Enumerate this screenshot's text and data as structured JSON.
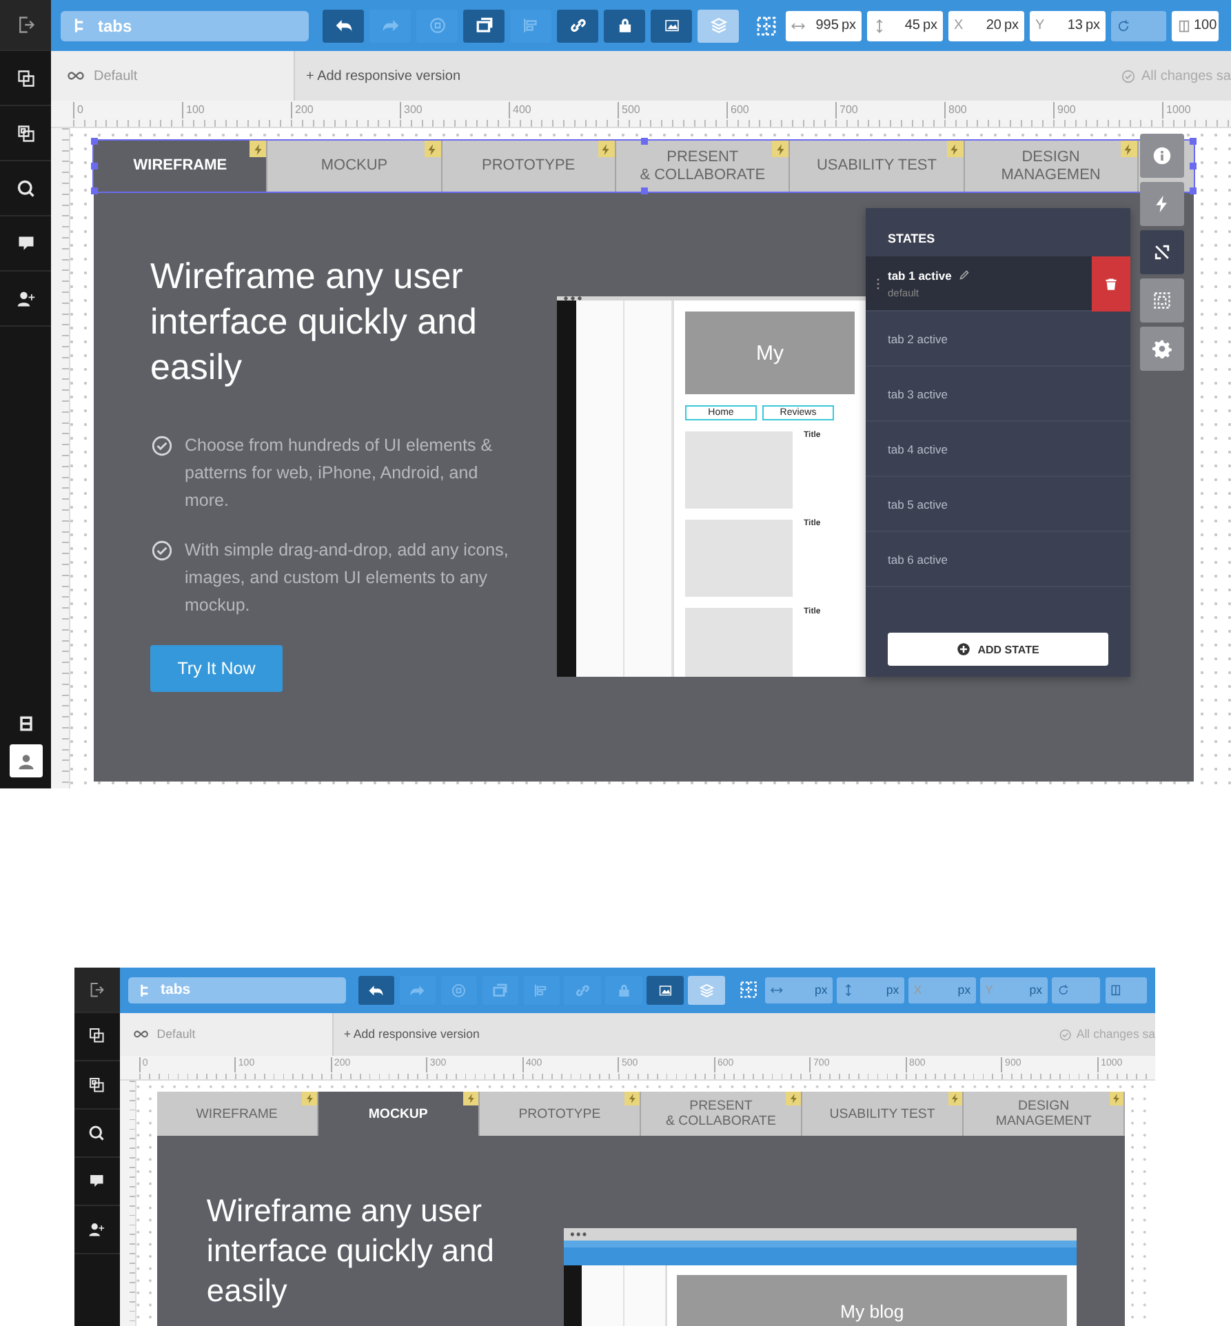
{
  "screens": [
    {
      "kind": "full",
      "element": "tabs",
      "sidebar": [
        {
          "kind": "exit"
        },
        {
          "kind": "pages"
        },
        {
          "kind": "masters"
        },
        {
          "kind": "search"
        },
        {
          "kind": "comment"
        },
        {
          "kind": "user-add"
        }
      ],
      "sidebar_bottom": [
        {
          "kind": "film"
        },
        {
          "kind": "avatar"
        }
      ],
      "tools": [
        {
          "kind": "undo",
          "disabled": false,
          "selected": false
        },
        {
          "kind": "redo",
          "disabled": true,
          "selected": false
        },
        {
          "kind": "group",
          "disabled": true,
          "selected": false
        },
        {
          "kind": "duplicate",
          "disabled": false,
          "selected": false
        },
        {
          "kind": "align",
          "disabled": true,
          "selected": false
        },
        {
          "kind": "link",
          "disabled": false,
          "selected": false
        },
        {
          "kind": "lock",
          "disabled": false,
          "selected": false
        },
        {
          "kind": "image",
          "disabled": false,
          "selected": false
        },
        {
          "kind": "layers",
          "disabled": false,
          "selected": true
        }
      ],
      "fields": [
        {
          "kind": "width",
          "value": "995",
          "unit": "px",
          "disabled": false
        },
        {
          "kind": "height",
          "value": "45",
          "unit": "px",
          "disabled": false
        },
        {
          "kind": "x",
          "label": "X",
          "value": "20",
          "unit": "px",
          "disabled": false
        },
        {
          "kind": "y",
          "label": "Y",
          "value": "13",
          "unit": "px",
          "disabled": false
        },
        {
          "kind": "rotation",
          "disabled": true
        },
        {
          "kind": "opacity",
          "value": "100",
          "disabled": false
        }
      ],
      "breakpoint": "Default",
      "add_version": "+ Add responsive version",
      "save_status": "All changes sa",
      "ruler": [
        "0",
        "100",
        "200",
        "300",
        "400",
        "500",
        "600",
        "700",
        "800",
        "900",
        "1000"
      ],
      "widget": {
        "selected": true,
        "tabs": [
          {
            "label": "WIREFRAME",
            "selected": true
          },
          {
            "label": "MOCKUP",
            "selected": false
          },
          {
            "label": "PROTOTYPE",
            "selected": false
          },
          {
            "label": "PRESENT\n& COLLABORATE",
            "selected": false
          },
          {
            "label": "USABILITY TEST",
            "selected": false
          },
          {
            "label": "DESIGN\nMANAGEMEN",
            "selected": false
          }
        ],
        "heading": "Wireframe any user interface quickly and easily",
        "bullets": [
          "Choose from hundreds of UI elements & patterns for web, iPhone, Android, and more.",
          "With simple drag-and-drop, add any icons, images, and custom UI elements to any mockup."
        ],
        "cta": "Try It Now",
        "screenshot": {
          "header": "My",
          "nav": [
            "Home",
            "Reviews"
          ],
          "cards": [
            "Title",
            "Title",
            "Title"
          ]
        }
      },
      "states": {
        "title": "STATES",
        "add": "ADD STATE",
        "items": [
          {
            "name": "tab 1 active",
            "note": "default",
            "selected": true
          },
          {
            "name": "tab 2 active",
            "selected": false
          },
          {
            "name": "tab 3 active",
            "selected": false
          },
          {
            "name": "tab 4 active",
            "selected": false
          },
          {
            "name": "tab 5 active",
            "selected": false
          },
          {
            "name": "tab 6 active",
            "selected": false
          }
        ]
      },
      "side_tools": [
        {
          "kind": "info",
          "selected": false
        },
        {
          "kind": "bolt",
          "selected": false
        },
        {
          "kind": "unlink",
          "selected": true
        },
        {
          "kind": "select-group",
          "selected": false
        },
        {
          "kind": "gear",
          "selected": false
        }
      ]
    },
    {
      "kind": "compact",
      "element": "tabs",
      "sidebar": [
        {
          "kind": "exit"
        },
        {
          "kind": "pages"
        },
        {
          "kind": "masters"
        },
        {
          "kind": "search"
        },
        {
          "kind": "comment"
        },
        {
          "kind": "user-add"
        }
      ],
      "tools": [
        {
          "kind": "undo",
          "disabled": false,
          "selected": false
        },
        {
          "kind": "redo",
          "disabled": true,
          "selected": false
        },
        {
          "kind": "group",
          "disabled": true,
          "selected": false
        },
        {
          "kind": "duplicate",
          "disabled": true,
          "selected": false
        },
        {
          "kind": "align",
          "disabled": true,
          "selected": false
        },
        {
          "kind": "link",
          "disabled": true,
          "selected": false
        },
        {
          "kind": "lock",
          "disabled": true,
          "selected": false
        },
        {
          "kind": "image",
          "disabled": false,
          "selected": false
        },
        {
          "kind": "layers",
          "disabled": false,
          "selected": true
        }
      ],
      "fields": [
        {
          "kind": "width",
          "unit": "px",
          "disabled": true
        },
        {
          "kind": "height",
          "unit": "px",
          "disabled": true
        },
        {
          "kind": "x",
          "label": "X",
          "unit": "px",
          "disabled": true
        },
        {
          "kind": "y",
          "label": "Y",
          "unit": "px",
          "disabled": true
        },
        {
          "kind": "rotation",
          "disabled": true
        },
        {
          "kind": "opacity",
          "disabled": true
        }
      ],
      "breakpoint": "Default",
      "add_version": "+ Add responsive version",
      "save_status": "All changes sa",
      "ruler": [
        "0",
        "100",
        "200",
        "300",
        "400",
        "500",
        "600",
        "700",
        "800",
        "900",
        "1000"
      ],
      "widget": {
        "selected": false,
        "tabs": [
          {
            "label": "WIREFRAME",
            "selected": false
          },
          {
            "label": "MOCKUP",
            "selected": true
          },
          {
            "label": "PROTOTYPE",
            "selected": false
          },
          {
            "label": "PRESENT\n& COLLABORATE",
            "selected": false
          },
          {
            "label": "USABILITY TEST",
            "selected": false
          },
          {
            "label": "DESIGN\nMANAGEMENT",
            "selected": false
          }
        ],
        "heading": "Wireframe any user interface quickly and easily",
        "screenshot": {
          "header": "My blog"
        }
      }
    }
  ]
}
